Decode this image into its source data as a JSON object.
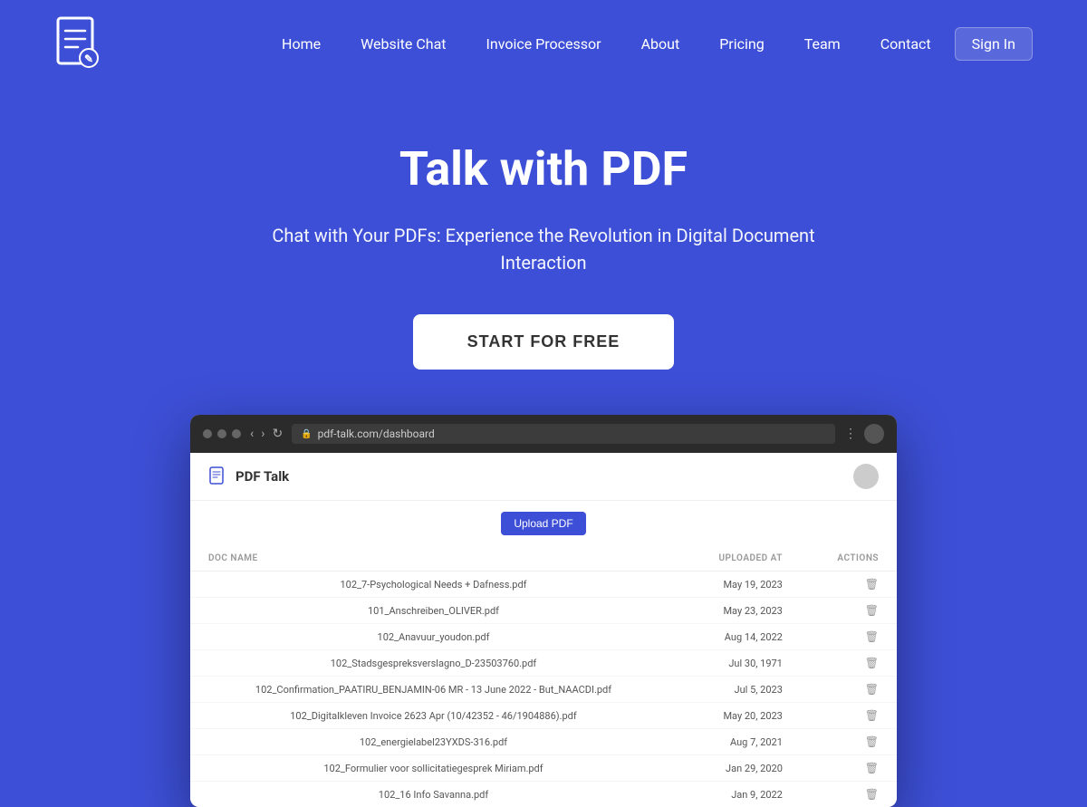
{
  "header": {
    "logo_alt": "PDF Talk Logo",
    "nav": {
      "home": "Home",
      "website_chat": "Website Chat",
      "invoice_processor": "Invoice Processor",
      "about": "About",
      "pricing": "Pricing",
      "team": "Team",
      "contact": "Contact",
      "sign_in": "Sign In"
    }
  },
  "hero": {
    "title": "Talk with PDF",
    "subtitle": "Chat with Your PDFs: Experience the Revolution in Digital Document Interaction",
    "cta": "START FOR FREE"
  },
  "browser": {
    "address": "pdf-talk.com/dashboard",
    "app_name": "PDF Talk",
    "upload_button": "Upload PDF",
    "table": {
      "columns": [
        "DOC NAME",
        "UPLOADED AT",
        "ACTIONS"
      ],
      "rows": [
        {
          "name": "102_7-Psychological Needs + Dafness.pdf",
          "date": "May 19, 2023"
        },
        {
          "name": "101_Anschreiben_OLIVER.pdf",
          "date": "May 23, 2023"
        },
        {
          "name": "102_Anavuur_youdon.pdf",
          "date": "Aug 14, 2022"
        },
        {
          "name": "102_Stadsgespreksverslagno_D-23503760.pdf",
          "date": "Jul 30, 1971"
        },
        {
          "name": "102_Confirmation_PAATIRU_BENJAMIN-06 MR - 13 June 2022 - But_NAACDI.pdf",
          "date": "Jul 5, 2023"
        },
        {
          "name": "102_Digitalkleven Invoice 2623 Apr (10/42352 - 46/1904886).pdf",
          "date": "May 20, 2023"
        },
        {
          "name": "102_energielabel23YXDS-316.pdf",
          "date": "Aug 7, 2021"
        },
        {
          "name": "102_Formulier voor sollicitatiegesprek Miriam.pdf",
          "date": "Jan 29, 2020"
        },
        {
          "name": "102_16 Info Savanna.pdf",
          "date": "Jan 9, 2022"
        }
      ]
    }
  },
  "colors": {
    "brand_blue": "#3d4fd6",
    "white": "#ffffff",
    "text_dark": "#333333",
    "text_muted": "#555555",
    "nav_bg": "#3d4fd6"
  }
}
